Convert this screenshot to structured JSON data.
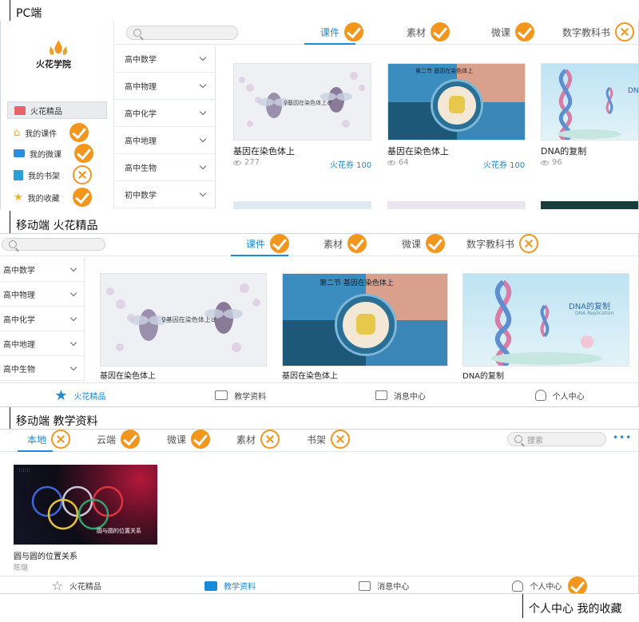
{
  "colors": {
    "accent": "#1a8bd8",
    "check": "#f2961e",
    "border": "#cfd6dd"
  },
  "sections": {
    "pc": "PC端",
    "mobile_featured": "移动端 火花精品",
    "mobile_teaching": "移动端 教学资料",
    "personal": "个人中心 我的收藏"
  },
  "pc": {
    "logo_text": "火花学院",
    "tabs": [
      {
        "label": "课件",
        "mark": "check",
        "active": true
      },
      {
        "label": "素材",
        "mark": "check",
        "active": false
      },
      {
        "label": "微课",
        "mark": "check",
        "active": false
      },
      {
        "label": "数字教科书",
        "mark": "cross",
        "active": false
      }
    ],
    "side": [
      {
        "label": "火花精品",
        "icon": "store-icon",
        "mark": ""
      },
      {
        "label": "我的课件",
        "icon": "home-icon",
        "mark": "check"
      },
      {
        "label": "我的微课",
        "icon": "video-icon",
        "mark": "check"
      },
      {
        "label": "我的书架",
        "icon": "book-icon",
        "mark": "cross"
      },
      {
        "label": "我的收藏",
        "icon": "star-icon",
        "mark": "check"
      }
    ],
    "categories": [
      "高中数学",
      "高中物理",
      "高中化学",
      "高中地理",
      "高中生物",
      "初中数学"
    ],
    "cards": [
      {
        "title": "基因在染色体上",
        "views": "277",
        "price": "火花券 100",
        "thumb": "genes-flies"
      },
      {
        "title": "基因在染色体上",
        "views": "64",
        "price": "火花券 100",
        "thumb": "chromosome-section"
      },
      {
        "title": "DNA的复制",
        "views": "96",
        "price": "",
        "thumb": "dna-helix"
      }
    ]
  },
  "mobile_featured": {
    "tabs": [
      {
        "label": "课件",
        "mark": "check",
        "active": true
      },
      {
        "label": "素材",
        "mark": "check",
        "active": false
      },
      {
        "label": "微课",
        "mark": "check",
        "active": false
      },
      {
        "label": "数字教科书",
        "mark": "cross",
        "active": false
      }
    ],
    "categories": [
      "高中数学",
      "高中物理",
      "高中化学",
      "高中地理",
      "高中生物"
    ],
    "cards": [
      {
        "title": "基因在染色体上",
        "thumb": "genes-flies"
      },
      {
        "title": "基因在染色体上",
        "thumb": "chromosome-section"
      },
      {
        "title": "DNA的复制",
        "thumb": "dna-helix"
      }
    ],
    "nav": [
      {
        "label": "火花精品",
        "icon": "star-icon",
        "active": true
      },
      {
        "label": "教学资料",
        "icon": "folder-icon",
        "active": false
      },
      {
        "label": "消息中心",
        "icon": "message-icon",
        "active": false
      },
      {
        "label": "个人中心",
        "icon": "user-icon",
        "active": false
      }
    ]
  },
  "mobile_teaching": {
    "tabs": [
      {
        "label": "本地",
        "mark": "cross",
        "active": true
      },
      {
        "label": "云端",
        "mark": "check",
        "active": false
      },
      {
        "label": "微课",
        "mark": "check",
        "active": false
      },
      {
        "label": "素材",
        "mark": "cross",
        "active": false
      },
      {
        "label": "书架",
        "mark": "cross",
        "active": false
      }
    ],
    "search_placeholder": "搜索",
    "file": {
      "title": "圆与圆的位置关系",
      "author": "陈璐",
      "thumb_caption": "圆与圆的位置关系"
    },
    "nav": [
      {
        "label": "火花精品",
        "icon": "star-icon",
        "active": false,
        "mark": ""
      },
      {
        "label": "教学资料",
        "icon": "folder-icon",
        "active": true,
        "mark": ""
      },
      {
        "label": "消息中心",
        "icon": "message-icon",
        "active": false,
        "mark": ""
      },
      {
        "label": "个人中心",
        "icon": "user-icon",
        "active": false,
        "mark": "check"
      }
    ]
  },
  "thumbs": {
    "genes_caption": "♀基因在染色体上♂",
    "chromosome_caption": "第二节 基因在染色体上",
    "dna_caption": "DNA的复制",
    "dna_sub": "DNA Replication"
  }
}
